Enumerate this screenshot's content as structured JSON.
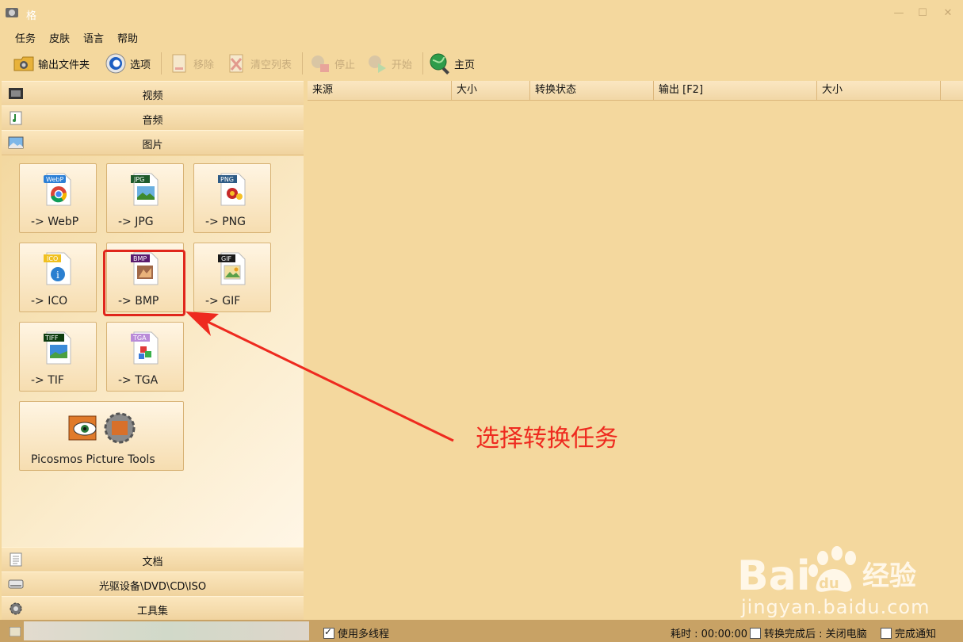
{
  "window": {
    "title": "格"
  },
  "menu": [
    "任务",
    "皮肤",
    "语言",
    "帮助"
  ],
  "toolbar": {
    "output_folder": "输出文件夹",
    "options": "选项",
    "remove": "移除",
    "clear_list": "清空列表",
    "stop": "停止",
    "start": "开始",
    "home": "主页"
  },
  "categories": {
    "video": "视频",
    "audio": "音频",
    "image": "图片",
    "document": "文档",
    "optical": "光驱设备\\DVD\\CD\\ISO",
    "tools": "工具集"
  },
  "tiles": [
    {
      "label": "-> WebP",
      "badge": "WebP",
      "badge_color": "#2b7fd6"
    },
    {
      "label": "-> JPG",
      "badge": "JPG",
      "badge_color": "#1e5a2c"
    },
    {
      "label": "-> PNG",
      "badge": "PNG",
      "badge_color": "#2d5b86"
    },
    {
      "label": "-> ICO",
      "badge": "ICO",
      "badge_color": "#f0c020"
    },
    {
      "label": "-> BMP",
      "badge": "BMP",
      "badge_color": "#5a1a6e"
    },
    {
      "label": "-> GIF",
      "badge": "GIF",
      "badge_color": "#1a1a1a"
    },
    {
      "label": "-> TIF",
      "badge": "TIFF",
      "badge_color": "#0e3d10"
    },
    {
      "label": "-> TGA",
      "badge": "TGA",
      "badge_color": "#b98ad8"
    },
    {
      "label": "Picosmos Picture Tools"
    }
  ],
  "list_columns": [
    "来源",
    "大小",
    "转换状态",
    "输出 [F2]",
    "大小"
  ],
  "annotation": "选择转换任务",
  "status": {
    "multithread": "使用多线程",
    "elapsed": "耗时 : 00:00:00",
    "after_convert": "转换完成后 : 关闭电脑",
    "notify": "完成通知"
  },
  "watermark": {
    "brand": "Bai du 经验",
    "url": "jingyan.baidu.com"
  },
  "colors": {
    "accent_red": "#e0261c",
    "background": "#f4d89e"
  }
}
